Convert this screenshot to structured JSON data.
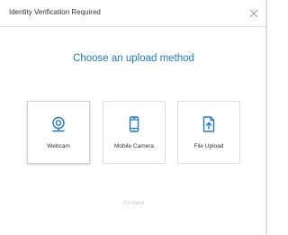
{
  "dialog": {
    "title": "Identity Verification Required",
    "close_icon": "close-icon"
  },
  "heading": "Choose an upload method",
  "options": [
    {
      "label": "Webcam",
      "icon": "webcam-icon",
      "selected": true
    },
    {
      "label": "Mobile Camera",
      "icon": "mobile-phone-icon",
      "selected": false
    },
    {
      "label": "File Upload",
      "icon": "file-upload-icon",
      "selected": false
    }
  ],
  "footer": {
    "go_back_label": "Go back"
  },
  "colors": {
    "accent": "#1f78c1",
    "text": "#333333",
    "muted": "#c9c9c9",
    "border": "#dedede"
  }
}
